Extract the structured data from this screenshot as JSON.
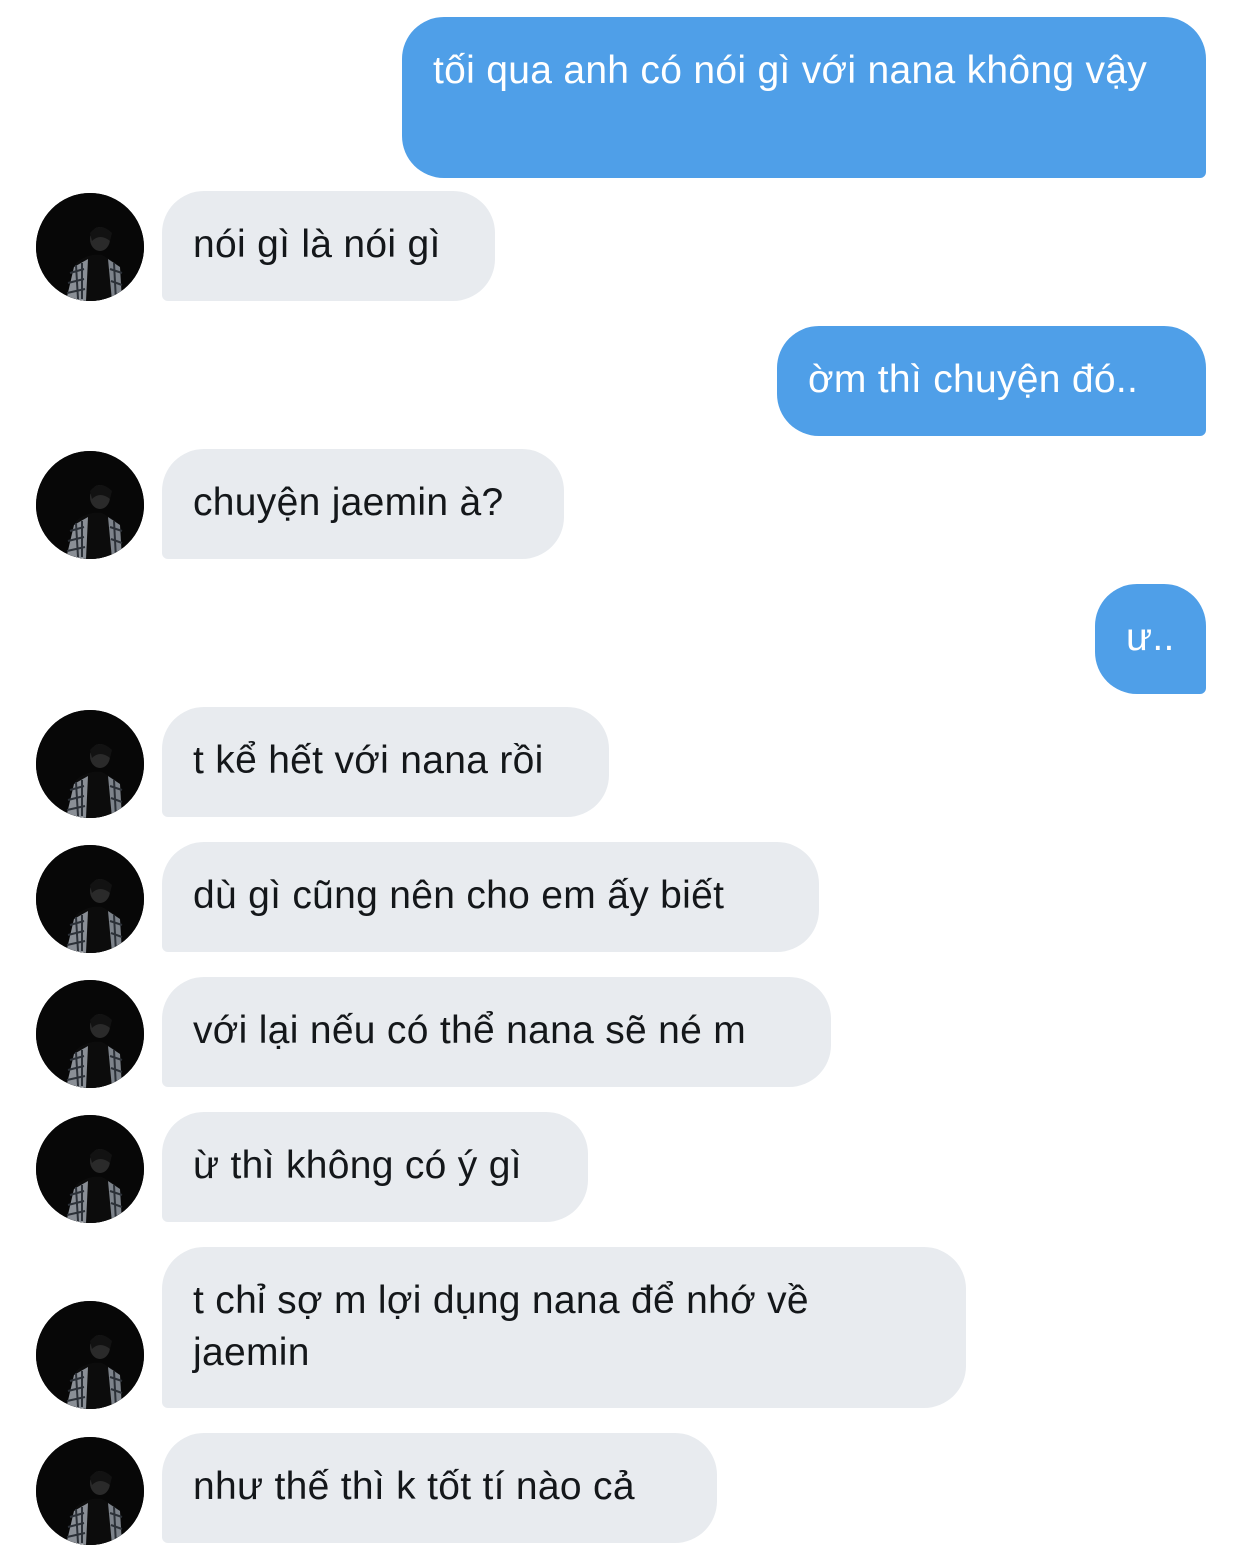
{
  "messages": [
    {
      "sender": "me",
      "text": "tối qua anh có nói gì với nana không vậy"
    },
    {
      "sender": "them",
      "text": "nói gì là nói gì"
    },
    {
      "sender": "me",
      "text": "ờm thì chuyện đó.."
    },
    {
      "sender": "them",
      "text": "chuyện jaemin à?"
    },
    {
      "sender": "me",
      "text": "ư.."
    },
    {
      "sender": "them",
      "text": "t kể hết với nana rồi"
    },
    {
      "sender": "them",
      "text": "dù gì cũng nên cho em ấy biết"
    },
    {
      "sender": "them",
      "text": "với lại nếu có thể nana sẽ né m"
    },
    {
      "sender": "them",
      "text": "ừ thì không có ý gì"
    },
    {
      "sender": "them",
      "text": "t chỉ sợ m lợi dụng nana để nhớ về jaemin"
    },
    {
      "sender": "them",
      "text": "như thế thì k tốt tí nào cả"
    }
  ],
  "colors": {
    "sent_bubble": "#4f9fe8",
    "received_bubble": "#e8ebef",
    "received_text": "#14171a",
    "background": "#ffffff"
  },
  "icons": {
    "avatar": "contact-avatar-photo"
  }
}
